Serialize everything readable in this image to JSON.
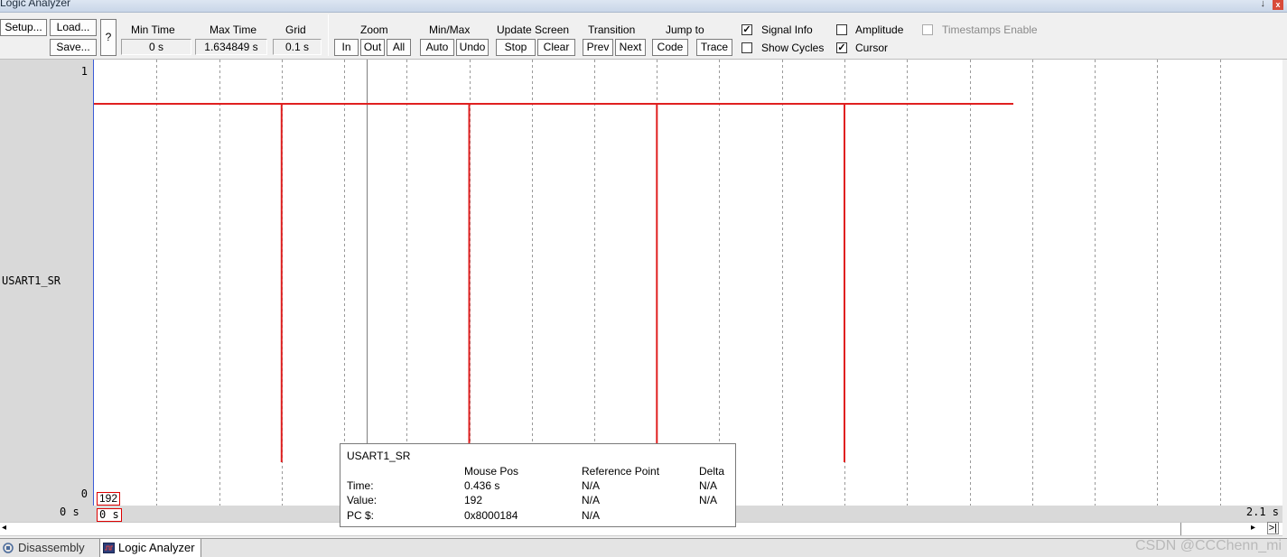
{
  "window": {
    "title": "Logic Analyzer",
    "pin_glyph": "↓",
    "close_glyph": "x"
  },
  "toolbar": {
    "setup": "Setup...",
    "load": "Load...",
    "save": "Save...",
    "help": "?",
    "min_time_label": "Min Time",
    "min_time_value": "0 s",
    "max_time_label": "Max Time",
    "max_time_value": "1.634849 s",
    "grid_label": "Grid",
    "grid_value": "0.1 s",
    "zoom_label": "Zoom",
    "zoom_in": "In",
    "zoom_out": "Out",
    "zoom_all": "All",
    "minmax_label": "Min/Max",
    "minmax_auto": "Auto",
    "minmax_undo": "Undo",
    "update_label": "Update Screen",
    "update_stop": "Stop",
    "update_clear": "Clear",
    "transition_label": "Transition",
    "transition_prev": "Prev",
    "transition_next": "Next",
    "jump_label": "Jump to",
    "jump_code": "Code",
    "jump_trace": "Trace",
    "signal_info": {
      "label": "Signal Info",
      "checked": true
    },
    "show_cycles": {
      "label": "Show Cycles",
      "checked": false
    },
    "amplitude": {
      "label": "Amplitude",
      "checked": false
    },
    "cursor": {
      "label": "Cursor",
      "checked": true
    },
    "timestamps": {
      "label": "Timestamps Enable",
      "checked": false,
      "disabled": true
    }
  },
  "signal_panel": {
    "y_max": "1",
    "y_min": "0",
    "signal_name": "USART1_SR"
  },
  "plot": {
    "signal_color": "#e02020",
    "grid_color": "#9a9a9a",
    "cursor_color": "#808080",
    "cursor_time_s": 0.436,
    "value_label": "192",
    "time_label": "0 s"
  },
  "time_axis": {
    "start": "0 s",
    "end": "2.1 s"
  },
  "chart_data": {
    "type": "line",
    "series": [
      {
        "name": "USART1_SR",
        "x": [
          0.0,
          0.3,
          0.3,
          0.3,
          0.6,
          0.6,
          0.6,
          0.9,
          0.9,
          0.9,
          1.2,
          1.2,
          1.2,
          1.47
        ],
        "y": [
          1,
          1,
          0,
          1,
          1,
          0,
          1,
          1,
          0,
          1,
          1,
          0,
          1,
          1
        ]
      }
    ],
    "xlim": [
      0,
      2.1
    ],
    "ylim": [
      0,
      1
    ],
    "grid": true,
    "grid_step": 0.1
  },
  "tooltip": {
    "signal": "USART1_SR",
    "col_mouse": "Mouse Pos",
    "col_ref": "Reference Point",
    "col_delta": "Delta",
    "row_time": "Time:",
    "row_value": "Value:",
    "row_pc": "PC $:",
    "mouse_time": "0.436 s",
    "mouse_value": "192",
    "mouse_pc": "0x8000184",
    "ref_time": "N/A",
    "ref_value": "N/A",
    "ref_pc": "N/A",
    "delta_time": "N/A",
    "delta_value": "N/A"
  },
  "scrollbar": {
    "left_arrow": "◂",
    "right_arrow": "▸",
    "end_button": ">|"
  },
  "tabs": [
    {
      "label": "Disassembly",
      "active": false
    },
    {
      "label": "Logic Analyzer",
      "active": true
    }
  ],
  "watermark": "CSDN @CCChenn_mi"
}
